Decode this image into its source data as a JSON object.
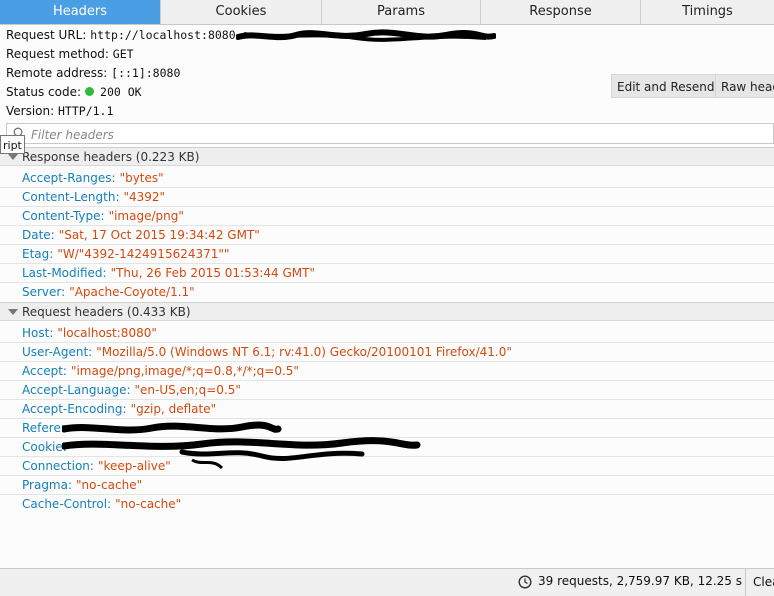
{
  "tabs": [
    "Headers",
    "Cookies",
    "Params",
    "Response",
    "Timings"
  ],
  "summary": {
    "request_url_label": "Request URL:",
    "request_url_value": "http://localhost:8080",
    "request_method_label": "Request method:",
    "request_method_value": "GET",
    "remote_address_label": "Remote address:",
    "remote_address_value": "[::1]:8080",
    "status_code_label": "Status code:",
    "status_code_value": "200 OK",
    "version_label": "Version:",
    "version_value": "HTTP/1.1"
  },
  "buttons": {
    "edit_resend": "Edit and Resend",
    "raw_headers": "Raw heade"
  },
  "filter": {
    "placeholder": "Filter headers"
  },
  "tooltip": "ript",
  "response_headers": {
    "title": "Response headers (0.223 KB)",
    "rows": [
      {
        "key": "Accept-Ranges:",
        "value": "\"bytes\""
      },
      {
        "key": "Content-Length:",
        "value": "\"4392\""
      },
      {
        "key": "Content-Type:",
        "value": "\"image/png\""
      },
      {
        "key": "Date:",
        "value": "\"Sat, 17 Oct 2015 19:34:42 GMT\""
      },
      {
        "key": "Etag:",
        "value": "\"W/\"4392-1424915624371\"\""
      },
      {
        "key": "Last-Modified:",
        "value": "\"Thu, 26 Feb 2015 01:53:44 GMT\""
      },
      {
        "key": "Server:",
        "value": "\"Apache-Coyote/1.1\""
      }
    ]
  },
  "request_headers": {
    "title": "Request headers (0.433 KB)",
    "rows": [
      {
        "key": "Host:",
        "value": "\"localhost:8080\""
      },
      {
        "key": "User-Agent:",
        "value": "\"Mozilla/5.0 (Windows NT 6.1; rv:41.0) Gecko/20100101 Firefox/41.0\""
      },
      {
        "key": "Accept:",
        "value": "\"image/png,image/*;q=0.8,*/*;q=0.5\""
      },
      {
        "key": "Accept-Language:",
        "value": "\"en-US,en;q=0.5\""
      },
      {
        "key": "Accept-Encoding:",
        "value": "\"gzip, deflate\""
      },
      {
        "key": "Referer:",
        "value": ""
      },
      {
        "key": "Cookie:",
        "value": ""
      },
      {
        "key": "Connection:",
        "value": "\"keep-alive\""
      },
      {
        "key": "Pragma:",
        "value": "\"no-cache\""
      },
      {
        "key": "Cache-Control:",
        "value": "\"no-cache\""
      }
    ]
  },
  "status_bar": {
    "summary": "39 requests, 2,759.97 KB, 12.25 s",
    "clear": "Clea"
  },
  "colors": {
    "active_tab": "#4a9fe4",
    "header_key": "#1580b8",
    "header_value": "#d24a0f",
    "status_ok": "#2fba3c"
  },
  "icons": [
    "search-icon",
    "collapse-triangle-icon",
    "clock-icon",
    "status-dot-icon"
  ]
}
